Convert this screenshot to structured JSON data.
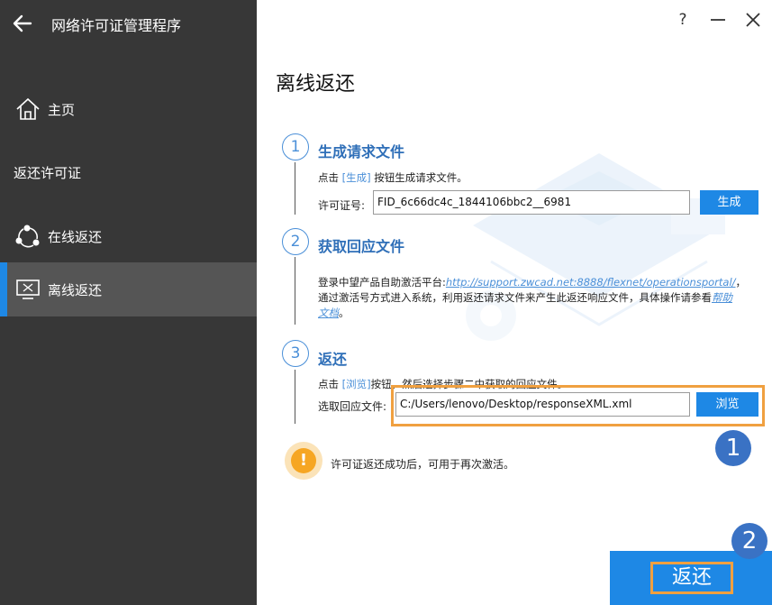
{
  "app": {
    "title": "网络许可证管理程序"
  },
  "sidebar": {
    "home_label": "主页",
    "section_label": "返还许可证",
    "online_label": "在线返还",
    "offline_label": "离线返还"
  },
  "window": {
    "help": "?"
  },
  "page": {
    "title": "离线返还"
  },
  "step1": {
    "number": "1",
    "title": "生成请求文件",
    "desc_prefix": "点击 ",
    "desc_highlight": "[生成]",
    "desc_suffix": " 按钮生成请求文件。",
    "field_label": "许可证号:",
    "field_value": "FID_6c66dc4c_1844106bbc2__6981",
    "button": "生成"
  },
  "step2": {
    "number": "2",
    "title": "获取回应文件",
    "line1_prefix": "登录中望产品自助激活平台:",
    "link": "http://support.zwcad.net:8888/flexnet/operationsportal/",
    "line1_suffix": "，",
    "line2": "通过激活号方式进入系统，利用返还请求文件来产生此返还响应文件，具体操作请参看",
    "help_link_part1": "帮助",
    "help_link_part2": "文档",
    "line3_suffix": "。"
  },
  "step3": {
    "number": "3",
    "title": "返还",
    "desc_prefix": "点击 ",
    "desc_highlight": "[浏览]",
    "desc_suffix": "按钮，然后选择步骤二中获取的回应文件。",
    "field_label": "选取回应文件:",
    "field_value": "C:/Users/lenovo/Desktop/responseXML.xml",
    "button": "浏览"
  },
  "notice": {
    "text": "许可证返还成功后，可用于再次激活。"
  },
  "callouts": {
    "one": "1",
    "two": "2"
  },
  "footer": {
    "return_label": "返还"
  },
  "colors": {
    "accent": "#1e88e5",
    "highlight": "#f0a040",
    "sidebar": "#373737"
  }
}
